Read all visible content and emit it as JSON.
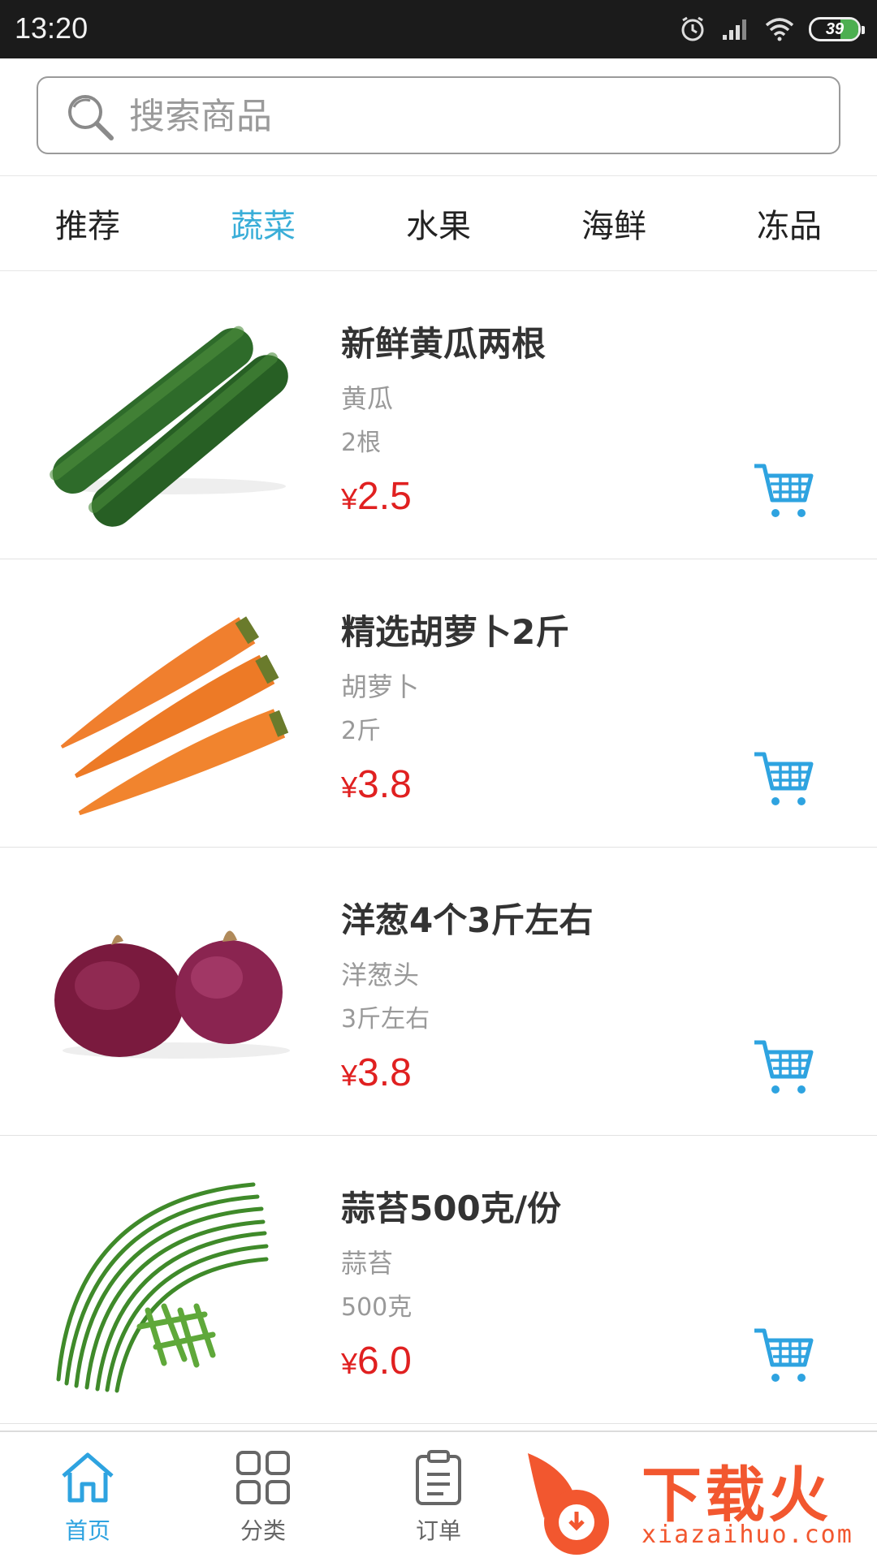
{
  "status_bar": {
    "time": "13:20",
    "battery": "39"
  },
  "search": {
    "placeholder": "搜索商品"
  },
  "tabs": [
    {
      "label": "推荐",
      "active": false
    },
    {
      "label": "蔬菜",
      "active": true
    },
    {
      "label": "水果",
      "active": false
    },
    {
      "label": "海鲜",
      "active": false
    },
    {
      "label": "冻品",
      "active": false
    }
  ],
  "products": [
    {
      "name": "新鲜黄瓜两根",
      "subtitle": "黄瓜",
      "spec": "2根",
      "currency": "¥",
      "price": "2.5",
      "image": "cucumber"
    },
    {
      "name": "精选胡萝卜2斤",
      "subtitle": "胡萝卜",
      "spec": "2斤",
      "currency": "¥",
      "price": "3.8",
      "image": "carrot"
    },
    {
      "name": "洋葱4个3斤左右",
      "subtitle": "洋葱头",
      "spec": "3斤左右",
      "currency": "¥",
      "price": "3.8",
      "image": "onion"
    },
    {
      "name": "蒜苔500克/份",
      "subtitle": "蒜苔",
      "spec": "500克",
      "currency": "¥",
      "price": "6.0",
      "image": "garlic-scape"
    }
  ],
  "bottom_nav": [
    {
      "label": "首页",
      "icon": "home-icon",
      "active": true
    },
    {
      "label": "分类",
      "icon": "grid-icon",
      "active": false
    },
    {
      "label": "订单",
      "icon": "clipboard-icon",
      "active": false
    }
  ],
  "watermark": {
    "text": "下载火",
    "url": "xiazaihuo.com"
  },
  "colors": {
    "accent": "#3aaed8",
    "price": "#e02020",
    "cart": "#2ea3e0",
    "watermark": "#f2572f"
  }
}
